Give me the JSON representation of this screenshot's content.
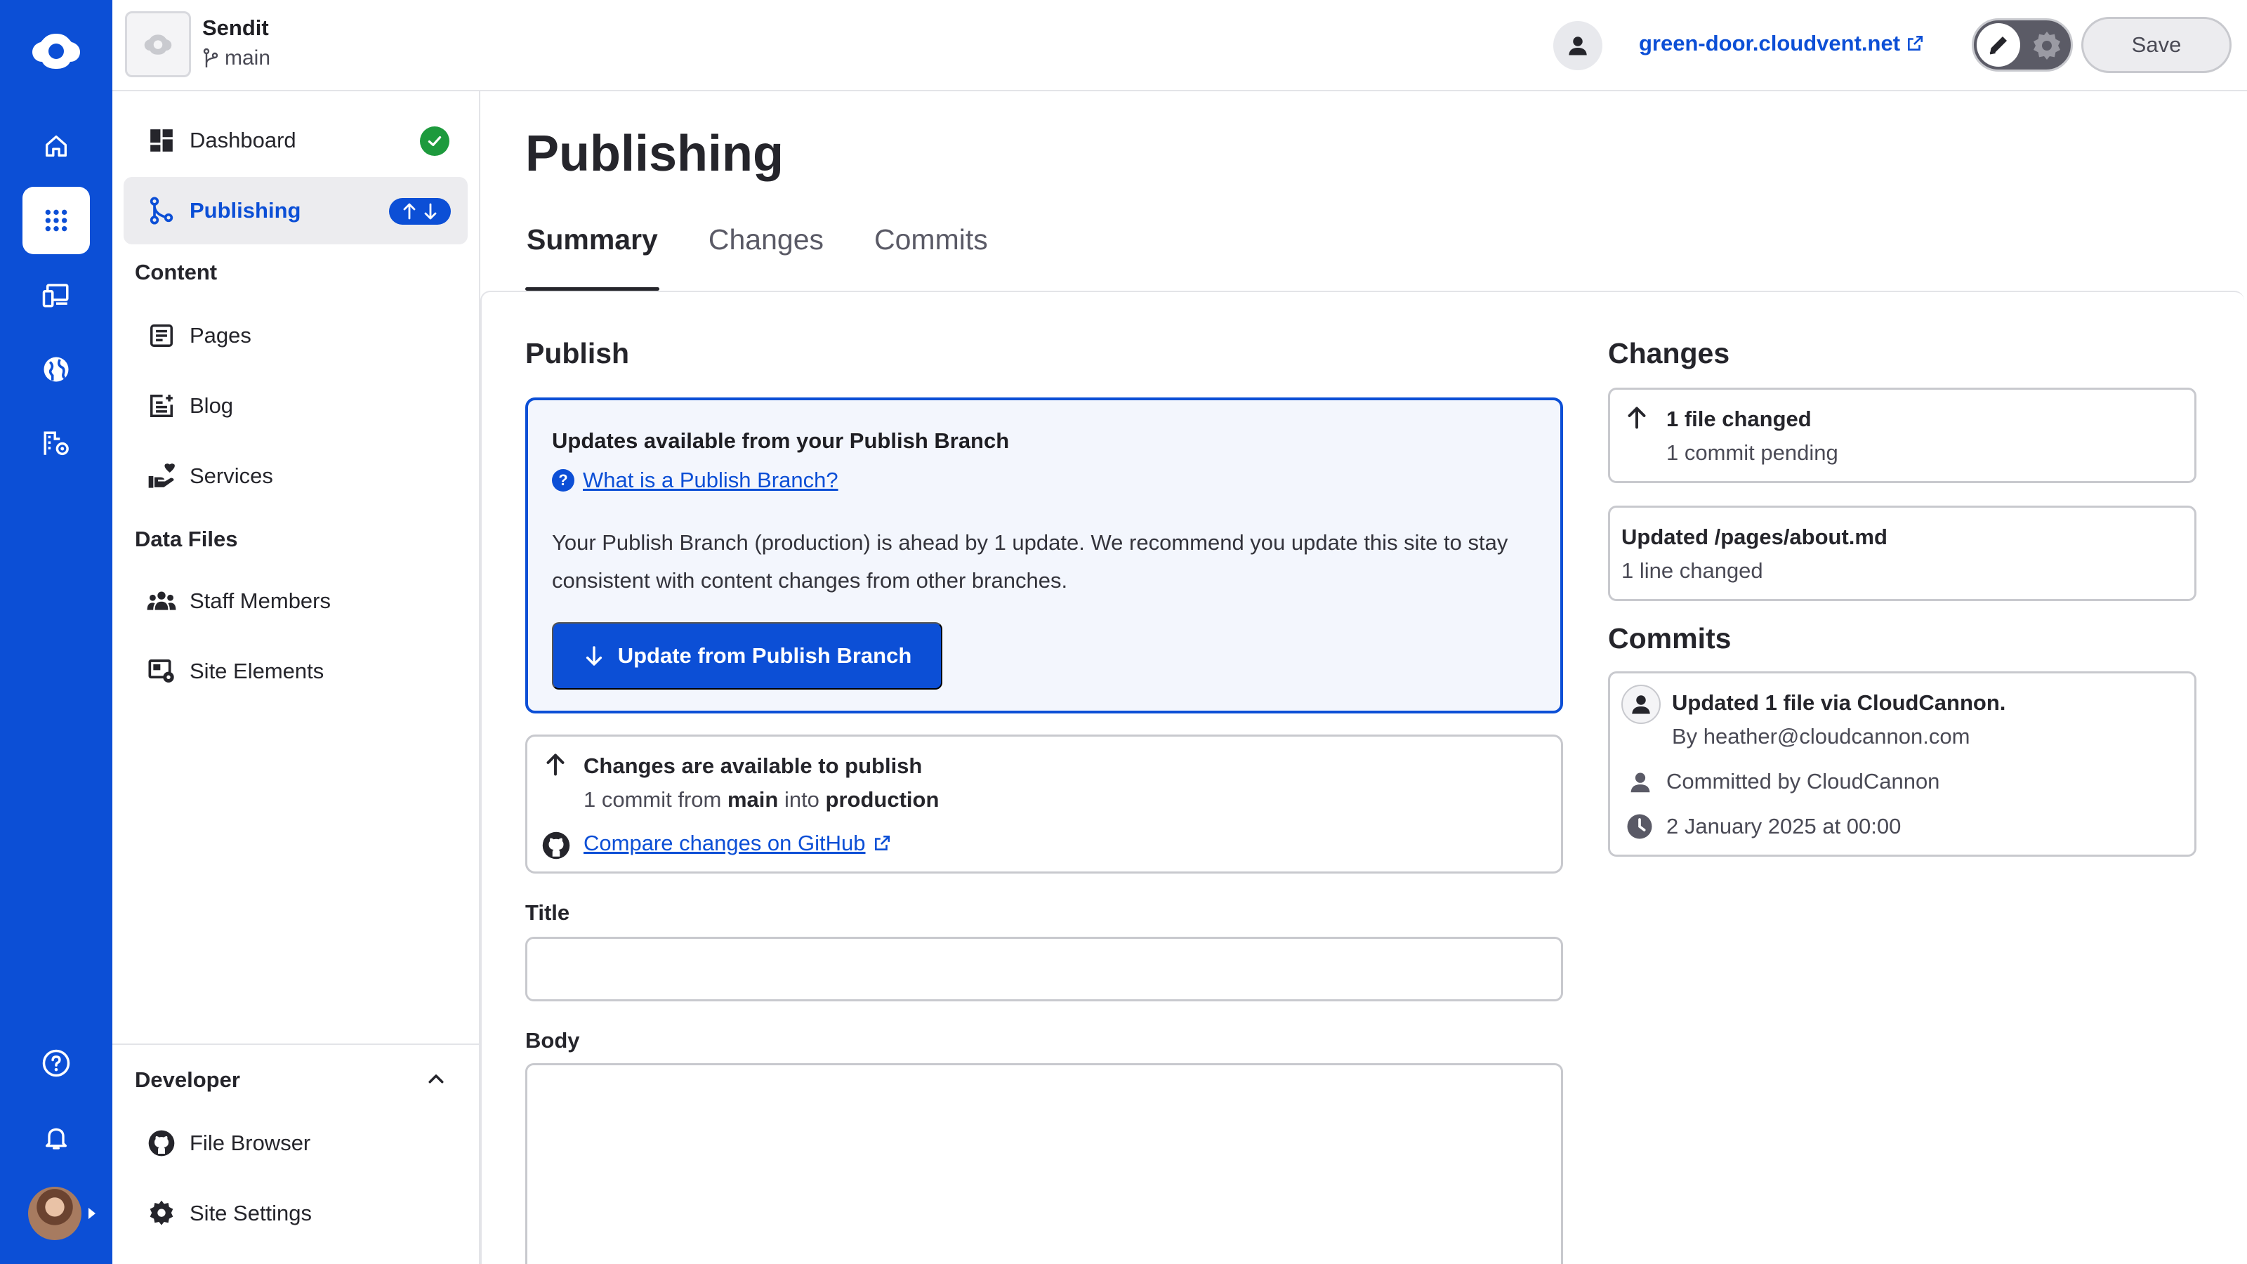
{
  "site": {
    "name": "Sendit",
    "branch": "main"
  },
  "topbar": {
    "domain": "green-door.cloudvent.net",
    "save_label": "Save"
  },
  "sidebar": {
    "items": [
      {
        "label": "Dashboard"
      },
      {
        "label": "Publishing"
      }
    ],
    "content_group": "Content",
    "content_items": [
      {
        "label": "Pages"
      },
      {
        "label": "Blog"
      },
      {
        "label": "Services"
      }
    ],
    "data_group": "Data Files",
    "data_items": [
      {
        "label": "Staff Members"
      },
      {
        "label": "Site Elements"
      }
    ],
    "developer": {
      "label": "Developer",
      "items": [
        {
          "label": "File Browser"
        },
        {
          "label": "Site Settings"
        }
      ]
    }
  },
  "page": {
    "title": "Publishing",
    "tabs": [
      "Summary",
      "Changes",
      "Commits"
    ],
    "active_tab": "Summary"
  },
  "publish": {
    "heading": "Publish",
    "notice": {
      "title": "Updates available from your Publish Branch",
      "help_link": "What is a Publish Branch?",
      "help_icon": "?",
      "body": "Your Publish Branch (production) is ahead by 1 update. We recommend you update this site to stay consistent with content changes from other branches.",
      "button": "Update from Publish Branch"
    },
    "changes_box": {
      "title": "Changes are available to publish",
      "line_prefix": "1 commit from ",
      "from_branch": "main",
      "line_middle": " into ",
      "to_branch": "production",
      "compare_link": "Compare changes on GitHub"
    },
    "title_label": "Title",
    "title_value": "",
    "body_label": "Body",
    "body_value": ""
  },
  "changes": {
    "heading": "Changes",
    "summary": {
      "files": "1 file changed",
      "commits": "1 commit pending"
    },
    "file": {
      "name": "Updated /pages/about.md",
      "detail": "1 line changed"
    }
  },
  "commits": {
    "heading": "Commits",
    "items": [
      {
        "message": "Updated 1 file via CloudCannon.",
        "author": "By heather@cloudcannon.com",
        "committer": "Committed by CloudCannon",
        "date": "2 January 2025 at 00:00"
      }
    ]
  },
  "colors": {
    "brand": "#0c4fd6",
    "success": "#1d9a3d",
    "border": "#c8c9ce",
    "text": "#25252b"
  }
}
